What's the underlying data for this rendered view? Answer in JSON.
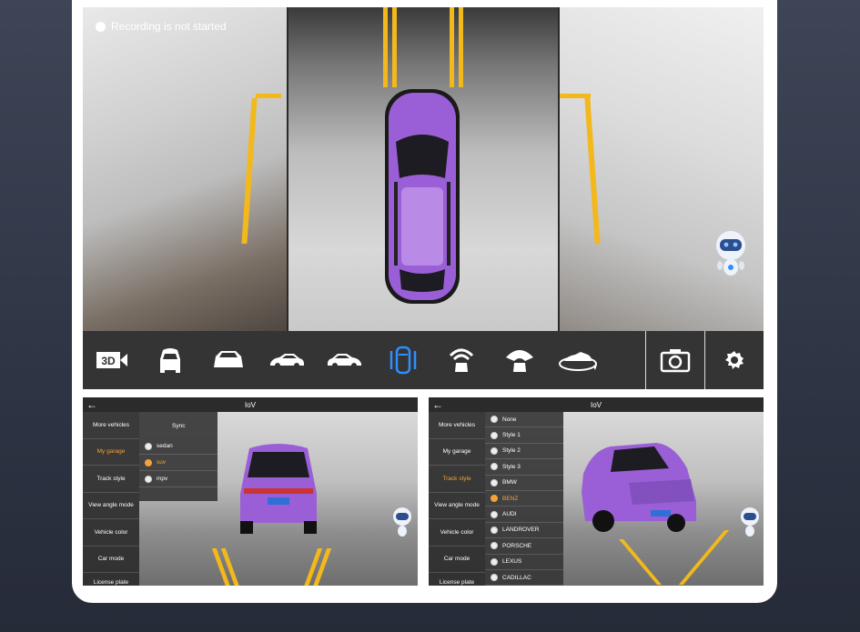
{
  "recording_status": "Recording is not started",
  "toolbar": {
    "buttons": [
      "3d-view-icon",
      "front-view-icon",
      "rear-view-icon",
      "left-view-icon",
      "right-view-icon",
      "top-view-icon",
      "front-radar-icon",
      "rear-radar-icon",
      "rotate-view-icon"
    ],
    "three_d_label": "3D",
    "active_button": "top-view-icon",
    "active_color": "#2f8fff"
  },
  "left_panel": {
    "header_title": "IoV",
    "menu": [
      "More vehicles",
      "My garage",
      "Track style",
      "View angle mode",
      "Vehicle color",
      "Car mode",
      "License plate settings"
    ],
    "selected_menu": "My garage",
    "submenu_title": "Sync",
    "submenu": [
      "sedan",
      "suv",
      "mpv"
    ],
    "selected_submenu": "suv"
  },
  "right_panel": {
    "header_title": "IoV",
    "menu": [
      "More vehicles",
      "My garage",
      "Track style",
      "View angle mode",
      "Vehicle color",
      "Car mode",
      "License plate settings"
    ],
    "selected_menu": "Track style",
    "submenu": [
      "None",
      "Style 1",
      "Style 2",
      "Style 3",
      "BMW",
      "BENZ",
      "AUDI",
      "LANDROVER",
      "PORSCHE",
      "LEXUS",
      "CADILLAC"
    ],
    "selected_submenu": "BENZ"
  },
  "colors": {
    "accent": "#f4a23a",
    "car": "#9a5fd6",
    "lane": "#f2b81c"
  }
}
